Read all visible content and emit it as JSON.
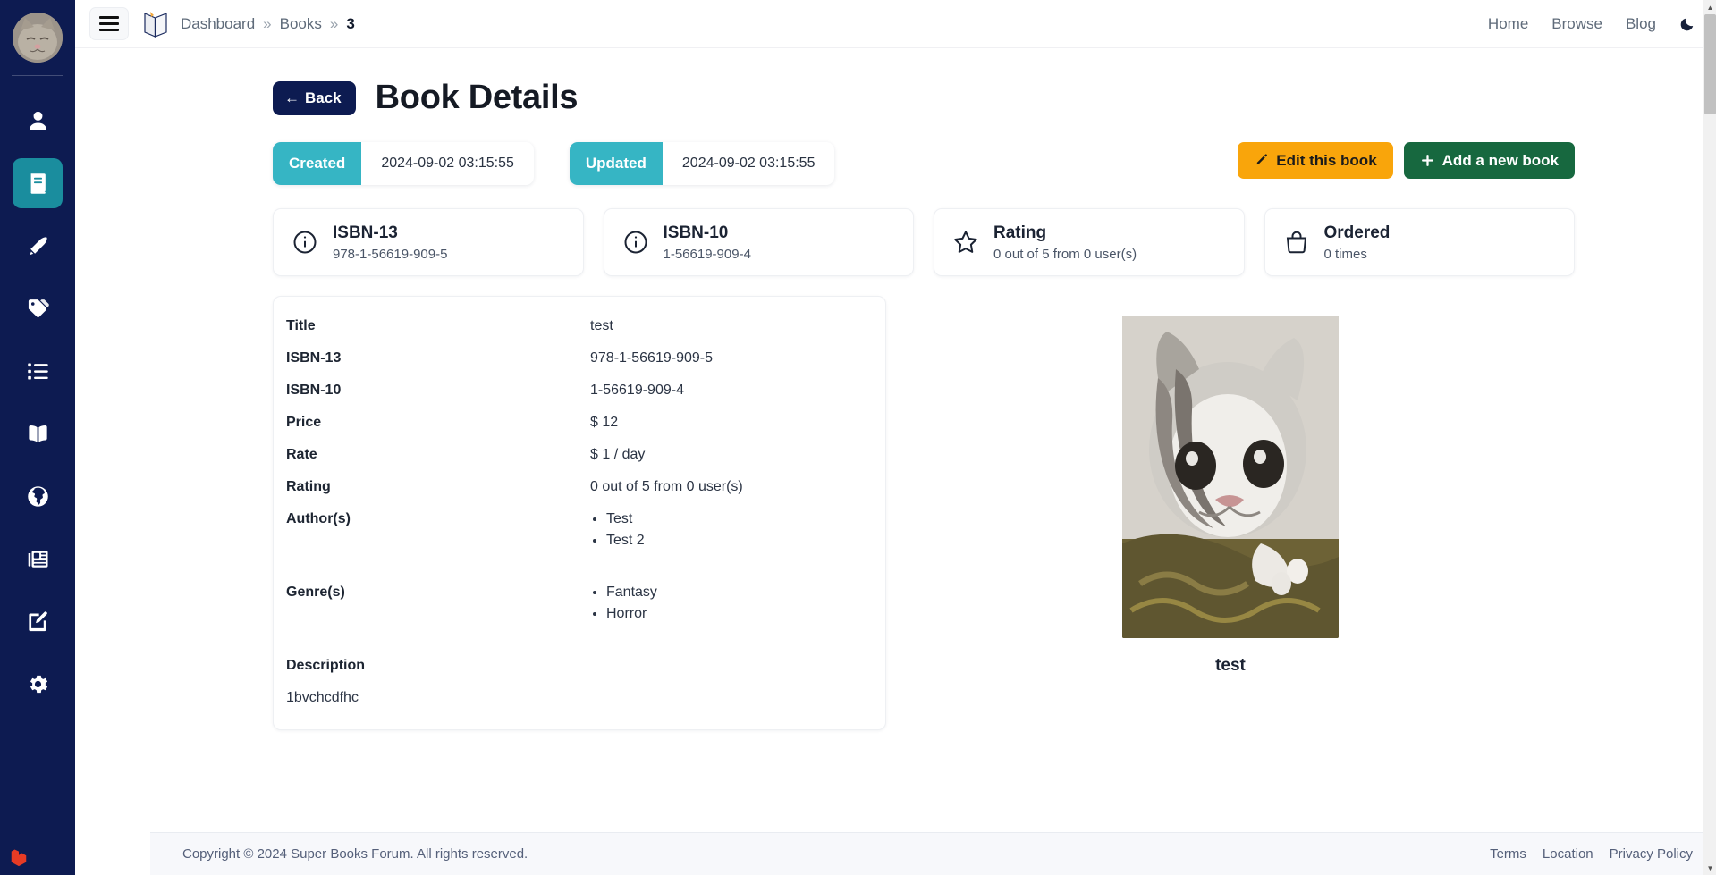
{
  "colors": {
    "sidebar_bg": "#0d1b51",
    "accent_teal": "#36b5c4",
    "accent_orange": "#f9a50b",
    "accent_green": "#17683f",
    "navy": "#0d1b51"
  },
  "sidebar": {
    "avatar_alt": "cat-avatar",
    "items": [
      {
        "name": "sidebar-item-profile",
        "icon": "user-icon",
        "active": false
      },
      {
        "name": "sidebar-item-books",
        "icon": "book-icon",
        "active": true
      },
      {
        "name": "sidebar-item-authors",
        "icon": "pen-nib-icon",
        "active": false
      },
      {
        "name": "sidebar-item-genres",
        "icon": "tags-icon",
        "active": false
      },
      {
        "name": "sidebar-item-lists",
        "icon": "list-icon",
        "active": false
      },
      {
        "name": "sidebar-item-library",
        "icon": "open-book-icon",
        "active": false
      },
      {
        "name": "sidebar-item-world",
        "icon": "globe-icon",
        "active": false
      },
      {
        "name": "sidebar-item-news",
        "icon": "newspaper-icon",
        "active": false
      },
      {
        "name": "sidebar-item-blog",
        "icon": "edit-square-icon",
        "active": false
      },
      {
        "name": "sidebar-item-settings",
        "icon": "gear-icon",
        "active": false
      }
    ]
  },
  "topbar": {
    "menu_icon": "hamburger-icon",
    "logo_icon": "open-book-logo",
    "breadcrumb": [
      {
        "label": "Dashboard",
        "current": false
      },
      {
        "label": "Books",
        "current": false
      },
      {
        "label": "3",
        "current": true
      }
    ],
    "separator": "»",
    "nav": [
      {
        "label": "Home"
      },
      {
        "label": "Browse"
      },
      {
        "label": "Blog"
      }
    ],
    "theme_toggle_icon": "moon-icon"
  },
  "page": {
    "back_label": "Back",
    "back_arrow": "←",
    "title": "Book Details"
  },
  "meta": {
    "created_label": "Created",
    "created_value": "2024-09-02 03:15:55",
    "updated_label": "Updated",
    "updated_value": "2024-09-02 03:15:55"
  },
  "actions": {
    "edit_label": "Edit this book",
    "edit_icon": "pencil-icon",
    "add_label": "Add a new book",
    "add_icon": "plus-icon"
  },
  "stats": [
    {
      "title": "ISBN-13",
      "sub": "978-1-56619-909-5",
      "icon": "info-circle-icon"
    },
    {
      "title": "ISBN-10",
      "sub": "1-56619-909-4",
      "icon": "info-circle-icon"
    },
    {
      "title": "Rating",
      "sub": "0 out of 5 from 0 user(s)",
      "icon": "star-icon"
    },
    {
      "title": "Ordered",
      "sub": "0 times",
      "icon": "bag-icon"
    }
  ],
  "details": {
    "rows": [
      {
        "key": "Title",
        "value": "test",
        "type": "text"
      },
      {
        "key": "ISBN-13",
        "value": "978-1-56619-909-5",
        "type": "text"
      },
      {
        "key": "ISBN-10",
        "value": "1-56619-909-4",
        "type": "text"
      },
      {
        "key": "Price",
        "value": "$ 12",
        "type": "text"
      },
      {
        "key": "Rate",
        "value": "$ 1 / day",
        "type": "text"
      },
      {
        "key": "Rating",
        "value": "0 out of 5 from 0 user(s)",
        "type": "text"
      },
      {
        "key": "Author(s)",
        "items": [
          "Test",
          "Test 2"
        ],
        "type": "list"
      },
      {
        "key": "Genre(s)",
        "items": [
          "Fantasy",
          "Horror"
        ],
        "type": "list"
      }
    ],
    "description_label": "Description",
    "description_value": "1bvchcdfhc"
  },
  "cover": {
    "caption": "test",
    "alt": "book-cover-cat-photo"
  },
  "footer": {
    "copyright": "Copyright © 2024 Super Books Forum. All rights reserved.",
    "links": [
      {
        "label": "Terms"
      },
      {
        "label": "Location"
      },
      {
        "label": "Privacy Policy"
      }
    ]
  },
  "scrollbar": {
    "up_glyph": "▲",
    "down_glyph": "▼"
  }
}
